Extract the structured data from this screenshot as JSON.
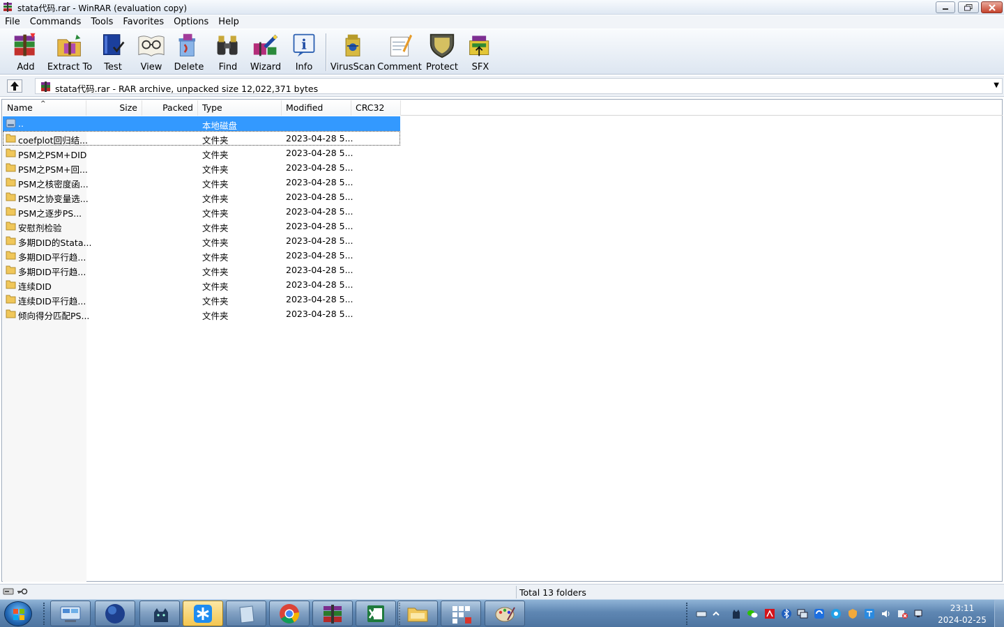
{
  "window": {
    "title": "stata代码.rar - WinRAR (evaluation copy)"
  },
  "menu": [
    "File",
    "Commands",
    "Tools",
    "Favorites",
    "Options",
    "Help"
  ],
  "toolbar": {
    "buttons": [
      "Add",
      "Extract To",
      "Test",
      "View",
      "Delete",
      "Find",
      "Wizard",
      "Info",
      "VirusScan",
      "Comment",
      "Protect",
      "SFX"
    ]
  },
  "address": {
    "text": "stata代码.rar - RAR archive, unpacked size 12,022,371 bytes"
  },
  "columns": [
    "Name",
    "Size",
    "Packed",
    "Type",
    "Modified",
    "CRC32"
  ],
  "files": [
    {
      "name": "..",
      "type": "本地磁盘",
      "modified": ""
    },
    {
      "name": "coefplot回归结...",
      "type": "文件夹",
      "modified": "2023-04-28 5..."
    },
    {
      "name": "PSM之PSM+DID",
      "type": "文件夹",
      "modified": "2023-04-28 5..."
    },
    {
      "name": "PSM之PSM+回...",
      "type": "文件夹",
      "modified": "2023-04-28 5..."
    },
    {
      "name": "PSM之核密度函...",
      "type": "文件夹",
      "modified": "2023-04-28 5..."
    },
    {
      "name": "PSM之协变量选...",
      "type": "文件夹",
      "modified": "2023-04-28 5..."
    },
    {
      "name": "PSM之逐步PS...",
      "type": "文件夹",
      "modified": "2023-04-28 5..."
    },
    {
      "name": "安慰剂检验",
      "type": "文件夹",
      "modified": "2023-04-28 5..."
    },
    {
      "name": "多期DID的Stata...",
      "type": "文件夹",
      "modified": "2023-04-28 5..."
    },
    {
      "name": "多期DID平行趋...",
      "type": "文件夹",
      "modified": "2023-04-28 5..."
    },
    {
      "name": "多期DID平行趋...",
      "type": "文件夹",
      "modified": "2023-04-28 5..."
    },
    {
      "name": "连续DID",
      "type": "文件夹",
      "modified": "2023-04-28 5..."
    },
    {
      "name": "连续DID平行趋...",
      "type": "文件夹",
      "modified": "2023-04-28 5..."
    },
    {
      "name": "倾向得分匹配PS...",
      "type": "文件夹",
      "modified": "2023-04-28 5..."
    }
  ],
  "status": {
    "total": "Total 13 folders"
  },
  "taskbar": {
    "time": "23:11",
    "date": "2024-02-25"
  }
}
